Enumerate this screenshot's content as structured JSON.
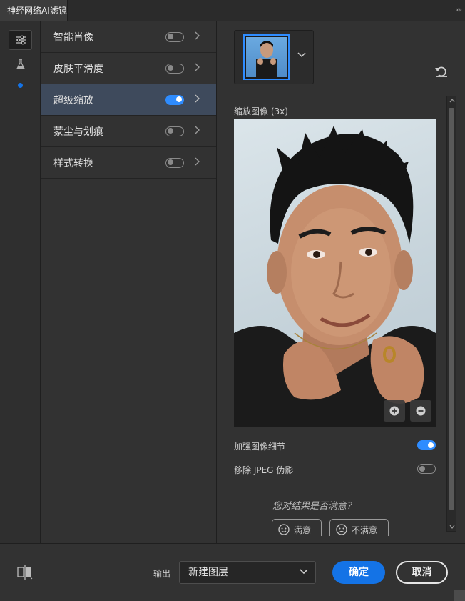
{
  "panel": {
    "tab_title": "神经网络AI滤镜",
    "collapse_glyph": "›››"
  },
  "rail": {
    "items": [
      "filters-icon",
      "flask-icon",
      "dot-indicator"
    ]
  },
  "filters": [
    {
      "label": "智能肖像",
      "enabled": false
    },
    {
      "label": "皮肤平滑度",
      "enabled": false
    },
    {
      "label": "超级缩放",
      "enabled": true
    },
    {
      "label": "蒙尘与划痕",
      "enabled": false
    },
    {
      "label": "样式转换",
      "enabled": false
    }
  ],
  "preview": {
    "title": "缩放图像 (3x)",
    "zoom_in_icon": "plus-circle-icon",
    "zoom_out_icon": "minus-circle-icon"
  },
  "options": [
    {
      "label": "加强图像细节",
      "enabled": true
    },
    {
      "label": "移除 JPEG 伪影",
      "enabled": false
    }
  ],
  "feedback": {
    "question": "您对结果是否满意？",
    "satisfied": "满意",
    "unsatisfied": "不满意"
  },
  "footer": {
    "output_label": "输出",
    "output_value": "新建图层",
    "ok_label": "确定",
    "cancel_label": "取消"
  },
  "colors": {
    "accent": "#1473e6",
    "toggle_on": "#2e8cff",
    "active_row": "#3e4a5c"
  }
}
